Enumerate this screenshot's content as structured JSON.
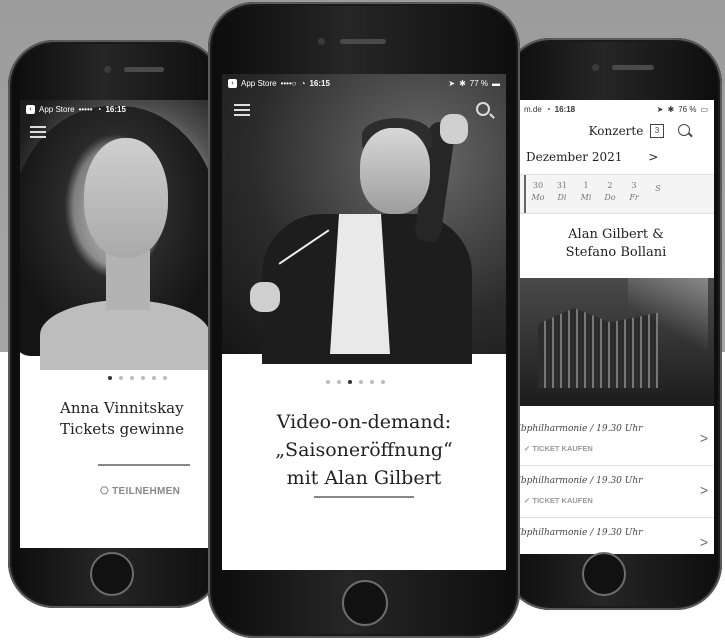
{
  "left_phone": {
    "status": {
      "carrier": "App Store",
      "signal": "•••••",
      "time": "16:15"
    },
    "dots": [
      true,
      false,
      false,
      false,
      false,
      false
    ],
    "title_line1": "Anna Vinnitskay",
    "title_line2": "Tickets gewinne",
    "action_label": "TEILNEHMEN"
  },
  "center_phone": {
    "status": {
      "carrier": "App Store",
      "signal": "••••○",
      "time": "16:15",
      "battery": "77 %"
    },
    "dots": [
      false,
      false,
      true,
      false,
      false,
      false
    ],
    "headline_line1": "Video-on-demand:",
    "headline_line2": "„Saisoneröffnung“",
    "headline_line3": "mit Alan Gilbert"
  },
  "right_phone": {
    "status": {
      "carrier": "m.de",
      "time": "16:18",
      "battery": "76 %"
    },
    "header_title": "Konzerte",
    "calendar_icon_day": "3",
    "month": "Dezember 2021",
    "month_arrow": ">",
    "days": [
      {
        "num": "30",
        "wd": "Mo"
      },
      {
        "num": "31",
        "wd": "Di"
      },
      {
        "num": "1",
        "wd": "Mi"
      },
      {
        "num": "2",
        "wd": "Do"
      },
      {
        "num": "3",
        "wd": "Fr"
      },
      {
        "num": "",
        "wd": "S"
      }
    ],
    "event_title_line1": "Alan Gilbert &",
    "event_title_line2": "Stefano Bollani",
    "events": [
      {
        "venue": "lbphilharmonie / 19.30 Uhr",
        "ticket": "TICKET KAUFEN"
      },
      {
        "venue": "lbphilharmonie / 19.30 Uhr",
        "ticket": "TICKET KAUFEN"
      },
      {
        "venue": "lbphilharmonie / 19.30 Uhr",
        "ticket": ""
      }
    ]
  }
}
